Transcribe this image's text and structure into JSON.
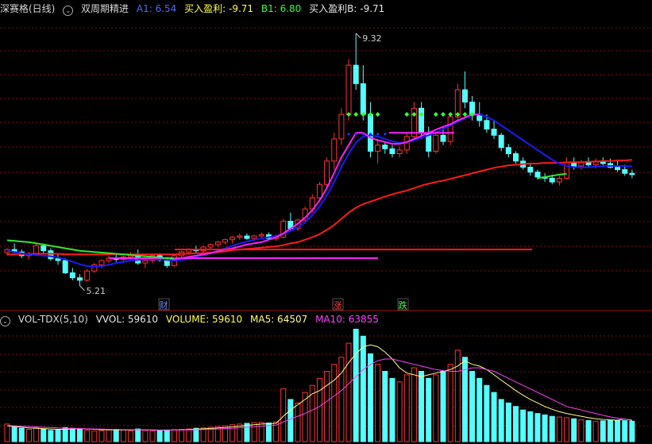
{
  "top_header": {
    "stock_name": "深赛格(日线)",
    "indicator_name": "双周期精进",
    "a1_label": "A1: 6.54",
    "buy_profit_label": "买入盈利: -9.71",
    "b1_label": "B1: 6.80",
    "buy_profit_b_label": "买入盈利B: -9.71"
  },
  "vol_header": {
    "indicator_name": "VOL-TDX(5,10)",
    "vvol_label": "VVOL: 59610",
    "volume_label": "VOLUME: 59610",
    "ma5_label": "MA5: 64507",
    "ma10_label": "MA10: 63855"
  },
  "annotations": {
    "high_price": "9.32",
    "low_price": "5.21",
    "marker_cai": "财",
    "marker_zhang": "涨",
    "marker_die": "跌"
  },
  "colors": {
    "up": "#ff3232",
    "down": "#54ffff",
    "ma_long_red": "#ff1a1a",
    "ma_magenta": "#ff20ff",
    "ma_blue": "#1a1aff",
    "ma_green": "#32e632",
    "grid": "#7a1010",
    "label_blue": "#4a6bff",
    "label_yellow": "#ffff44",
    "label_green": "#32ff32",
    "vol_ma5": "#ffff80",
    "vol_ma10": "#ff40ff"
  },
  "chart_data": [
    {
      "type": "candlestick",
      "title": "深赛格(日线)",
      "price_high": 9.32,
      "price_low": 5.21,
      "ylim": [
        5.0,
        9.5
      ],
      "candles": [
        [
          5.75,
          5.82,
          5.7,
          5.8
        ],
        [
          5.8,
          5.9,
          5.74,
          5.76
        ],
        [
          5.76,
          5.8,
          5.66,
          5.7
        ],
        [
          5.7,
          5.76,
          5.64,
          5.73
        ],
        [
          5.73,
          5.9,
          5.7,
          5.86
        ],
        [
          5.86,
          5.9,
          5.74,
          5.78
        ],
        [
          5.78,
          5.82,
          5.62,
          5.65
        ],
        [
          5.65,
          5.72,
          5.55,
          5.62
        ],
        [
          5.62,
          5.66,
          5.4,
          5.42
        ],
        [
          5.42,
          5.5,
          5.3,
          5.34
        ],
        [
          5.34,
          5.4,
          5.21,
          5.3
        ],
        [
          5.3,
          5.48,
          5.28,
          5.45
        ],
        [
          5.45,
          5.58,
          5.42,
          5.55
        ],
        [
          5.55,
          5.64,
          5.5,
          5.62
        ],
        [
          5.62,
          5.7,
          5.58,
          5.66
        ],
        [
          5.66,
          5.72,
          5.6,
          5.64
        ],
        [
          5.64,
          5.7,
          5.58,
          5.68
        ],
        [
          5.68,
          5.76,
          5.62,
          5.72
        ],
        [
          5.72,
          5.8,
          5.55,
          5.58
        ],
        [
          5.58,
          5.66,
          5.5,
          5.62
        ],
        [
          5.62,
          5.72,
          5.58,
          5.7
        ],
        [
          5.7,
          5.74,
          5.6,
          5.63
        ],
        [
          5.63,
          5.68,
          5.5,
          5.54
        ],
        [
          5.54,
          5.72,
          5.52,
          5.7
        ],
        [
          5.7,
          5.78,
          5.66,
          5.76
        ],
        [
          5.76,
          5.82,
          5.72,
          5.8
        ],
        [
          5.8,
          5.86,
          5.74,
          5.78
        ],
        [
          5.78,
          5.86,
          5.74,
          5.84
        ],
        [
          5.84,
          5.9,
          5.8,
          5.88
        ],
        [
          5.88,
          5.94,
          5.84,
          5.92
        ],
        [
          5.92,
          5.98,
          5.88,
          5.96
        ],
        [
          5.96,
          6.02,
          5.9,
          6.0
        ],
        [
          6.0,
          6.06,
          5.96,
          6.02
        ],
        [
          6.02,
          6.06,
          5.96,
          5.98
        ],
        [
          5.98,
          6.04,
          5.94,
          6.02
        ],
        [
          6.02,
          6.08,
          5.98,
          6.04
        ],
        [
          6.04,
          6.08,
          5.96,
          5.98
        ],
        [
          5.98,
          6.04,
          5.94,
          6.0
        ],
        [
          6.0,
          6.3,
          5.98,
          6.26
        ],
        [
          6.26,
          6.4,
          6.1,
          6.14
        ],
        [
          6.14,
          6.3,
          6.1,
          6.28
        ],
        [
          6.28,
          6.5,
          6.22,
          6.46
        ],
        [
          6.46,
          6.7,
          6.4,
          6.64
        ],
        [
          6.64,
          6.9,
          6.58,
          6.86
        ],
        [
          6.86,
          7.3,
          6.8,
          7.24
        ],
        [
          7.24,
          7.7,
          7.1,
          7.6
        ],
        [
          7.6,
          8.1,
          7.5,
          8.0
        ],
        [
          8.0,
          8.9,
          7.9,
          8.8
        ],
        [
          8.8,
          9.32,
          8.4,
          8.5
        ],
        [
          8.5,
          8.8,
          7.9,
          8.0
        ],
        [
          8.0,
          8.2,
          7.3,
          7.4
        ],
        [
          7.4,
          7.6,
          7.2,
          7.5
        ],
        [
          7.5,
          7.56,
          7.36,
          7.44
        ],
        [
          7.44,
          7.5,
          7.3,
          7.36
        ],
        [
          7.36,
          7.48,
          7.3,
          7.42
        ],
        [
          7.42,
          7.7,
          7.36,
          7.64
        ],
        [
          7.64,
          8.2,
          7.6,
          8.1
        ],
        [
          8.1,
          8.2,
          7.6,
          7.7
        ],
        [
          7.7,
          7.8,
          7.3,
          7.4
        ],
        [
          7.4,
          7.7,
          7.36,
          7.66
        ],
        [
          7.66,
          7.8,
          7.5,
          7.56
        ],
        [
          7.56,
          8.0,
          7.5,
          7.96
        ],
        [
          7.96,
          8.5,
          7.9,
          8.4
        ],
        [
          8.4,
          8.7,
          8.1,
          8.2
        ],
        [
          8.2,
          8.3,
          7.9,
          8.0
        ],
        [
          8.0,
          8.2,
          7.8,
          7.9
        ],
        [
          7.9,
          8.0,
          7.7,
          7.76
        ],
        [
          7.76,
          7.9,
          7.6,
          7.66
        ],
        [
          7.66,
          7.7,
          7.4,
          7.46
        ],
        [
          7.46,
          7.52,
          7.3,
          7.36
        ],
        [
          7.36,
          7.4,
          7.2,
          7.24
        ],
        [
          7.24,
          7.3,
          7.1,
          7.14
        ],
        [
          7.14,
          7.2,
          7.0,
          7.06
        ],
        [
          7.06,
          7.1,
          6.94,
          6.98
        ],
        [
          6.98,
          7.04,
          6.9,
          6.96
        ],
        [
          6.96,
          7.02,
          6.86,
          6.9
        ],
        [
          6.9,
          7.0,
          6.84,
          6.96
        ],
        [
          6.96,
          7.3,
          6.94,
          7.22
        ],
        [
          7.22,
          7.3,
          7.1,
          7.16
        ],
        [
          7.16,
          7.26,
          7.1,
          7.22
        ],
        [
          7.22,
          7.3,
          7.14,
          7.18
        ],
        [
          7.18,
          7.28,
          7.12,
          7.24
        ],
        [
          7.24,
          7.3,
          7.16,
          7.2
        ],
        [
          7.2,
          7.28,
          7.12,
          7.14
        ],
        [
          7.14,
          7.24,
          7.06,
          7.1
        ],
        [
          7.1,
          7.18,
          7.0,
          7.04
        ],
        [
          7.04,
          7.1,
          6.96,
          7.02
        ]
      ],
      "ma_long_red": [
        5.72,
        5.72,
        5.72,
        5.73,
        5.73,
        5.73,
        5.73,
        5.73,
        5.72,
        5.72,
        5.72,
        5.72,
        5.72,
        5.72,
        5.72,
        5.72,
        5.72,
        5.72,
        5.72,
        5.72,
        5.72,
        5.72,
        5.72,
        5.72,
        5.73,
        5.73,
        5.74,
        5.74,
        5.75,
        5.76,
        5.77,
        5.79,
        5.8,
        5.81,
        5.82,
        5.83,
        5.84,
        5.85,
        5.87,
        5.9,
        5.92,
        5.96,
        6.0,
        6.05,
        6.12,
        6.2,
        6.3,
        6.4,
        6.48,
        6.54,
        6.58,
        6.62,
        6.66,
        6.7,
        6.73,
        6.76,
        6.8,
        6.84,
        6.87,
        6.9,
        6.92,
        6.95,
        6.98,
        7.01,
        7.04,
        7.07,
        7.1,
        7.13,
        7.15,
        7.17,
        7.18,
        7.19,
        7.2,
        7.2,
        7.21,
        7.21,
        7.21,
        7.22,
        7.22,
        7.22,
        7.23,
        7.23,
        7.24,
        7.24,
        7.25,
        7.25,
        7.26
      ],
      "ma_magenta": [
        null,
        null,
        null,
        null,
        null,
        null,
        null,
        null,
        null,
        null,
        null,
        null,
        null,
        null,
        5.66,
        5.66,
        5.66,
        5.66,
        5.66,
        5.66,
        5.66,
        5.66,
        5.66,
        5.64,
        5.66,
        5.68,
        5.7,
        5.72,
        5.74,
        5.77,
        5.8,
        5.82,
        5.85,
        5.88,
        5.9,
        5.92,
        5.96,
        6.0,
        6.06,
        6.14,
        6.22,
        6.32,
        6.44,
        6.6,
        6.8,
        7.05,
        7.3,
        7.5,
        7.7,
        7.7,
        7.62,
        7.58,
        7.55,
        7.52,
        7.52,
        7.55,
        7.6,
        7.65,
        7.7,
        7.75,
        7.8,
        7.84,
        7.9,
        7.95,
        8.0,
        8.0,
        null,
        null,
        null,
        null,
        null,
        null,
        null,
        null,
        null,
        null,
        null,
        null,
        null,
        null,
        null,
        null,
        null,
        null,
        null,
        null,
        null
      ],
      "ma_blue": [
        5.78,
        5.76,
        5.74,
        5.72,
        5.71,
        5.7,
        5.69,
        5.67,
        5.64,
        5.6,
        5.56,
        5.53,
        5.52,
        5.53,
        5.55,
        5.58,
        5.6,
        5.62,
        5.63,
        5.64,
        5.64,
        5.64,
        5.63,
        5.62,
        5.63,
        5.65,
        5.68,
        5.71,
        5.74,
        5.78,
        5.82,
        5.86,
        5.9,
        5.93,
        5.96,
        5.98,
        6.0,
        6.02,
        6.06,
        6.1,
        6.16,
        6.24,
        6.36,
        6.5,
        6.68,
        6.9,
        7.14,
        7.36,
        7.54,
        7.64,
        7.66,
        7.64,
        7.6,
        7.56,
        7.54,
        7.55,
        7.58,
        7.62,
        7.66,
        7.7,
        7.76,
        7.82,
        7.88,
        7.94,
        7.98,
        8.0,
        7.96,
        7.9,
        7.82,
        7.74,
        7.66,
        7.58,
        7.5,
        7.42,
        7.34,
        7.26,
        7.2,
        7.16,
        7.14,
        7.14,
        7.14,
        7.15,
        7.16,
        7.16,
        7.16,
        7.16,
        7.15
      ],
      "ma_green": [
        5.95,
        5.94,
        5.93,
        5.92,
        5.9,
        5.88,
        5.86,
        5.84,
        5.82,
        5.8,
        5.78,
        5.77,
        5.76,
        5.75,
        5.74,
        5.73,
        5.72,
        5.71,
        5.7,
        5.69,
        5.68,
        5.67,
        5.66,
        5.66,
        null,
        null,
        null,
        null,
        null,
        null,
        null,
        null,
        null,
        null,
        null,
        null,
        null,
        null,
        null,
        null,
        null,
        null,
        null,
        null,
        null,
        null,
        null,
        null,
        null,
        null,
        null,
        null,
        null,
        null,
        null,
        null,
        null,
        null,
        null,
        null,
        null,
        null,
        null,
        null,
        null,
        null,
        null,
        null,
        null,
        null,
        null,
        null,
        null,
        6.96,
        6.98,
        7.0,
        7.02,
        7.03,
        null,
        null,
        null,
        null,
        null,
        null,
        null,
        null,
        null
      ]
    },
    {
      "type": "bar",
      "title": "VOL-TDX(5,10)",
      "series_name": "VOLUME",
      "values": [
        5000,
        4200,
        3800,
        3500,
        4000,
        3600,
        3200,
        3400,
        4000,
        3800,
        3600,
        3200,
        3000,
        3100,
        3300,
        3500,
        3400,
        3000,
        3600,
        3200,
        3000,
        3100,
        3300,
        3400,
        3500,
        3600,
        3800,
        3900,
        4100,
        4300,
        4500,
        4800,
        5000,
        5200,
        5400,
        5500,
        5300,
        5600,
        15000,
        12000,
        11000,
        14000,
        16000,
        18000,
        20000,
        22000,
        24000,
        28000,
        32000,
        30000,
        25000,
        22000,
        20000,
        18000,
        17000,
        19000,
        21000,
        20000,
        18000,
        19000,
        20000,
        22000,
        26000,
        24000,
        20000,
        18000,
        16000,
        14000,
        12000,
        11000,
        10000,
        9000,
        8500,
        8000,
        7600,
        7200,
        7000,
        6800,
        6500,
        6200,
        6000,
        5800,
        5900,
        6100,
        6000,
        5961,
        5800
      ],
      "ma5": [
        4500,
        4300,
        4100,
        3900,
        3800,
        3700,
        3600,
        3500,
        3500,
        3600,
        3700,
        3600,
        3500,
        3400,
        3400,
        3300,
        3300,
        3300,
        3350,
        3350,
        3300,
        3250,
        3250,
        3300,
        3350,
        3450,
        3550,
        3650,
        3750,
        3900,
        4050,
        4200,
        4400,
        4600,
        4800,
        5000,
        5100,
        5200,
        7200,
        9000,
        10500,
        12000,
        13600,
        14500,
        16000,
        17500,
        19500,
        22500,
        25000,
        27000,
        27500,
        27000,
        25500,
        23500,
        21000,
        19500,
        19000,
        18500,
        19000,
        19500,
        20000,
        20500,
        21500,
        23000,
        22000,
        21500,
        20500,
        19000,
        17500,
        16000,
        14500,
        13200,
        12000,
        11000,
        10000,
        9200,
        8500,
        8000,
        7600,
        7200,
        6800,
        6500,
        6300,
        6200,
        6100,
        6451,
        6000
      ],
      "ma10": [
        4600,
        4500,
        4400,
        4300,
        4200,
        4100,
        4000,
        3900,
        3800,
        3750,
        3700,
        3650,
        3600,
        3550,
        3500,
        3450,
        3400,
        3380,
        3360,
        3340,
        3320,
        3300,
        3300,
        3310,
        3320,
        3350,
        3400,
        3450,
        3500,
        3600,
        3700,
        3800,
        3950,
        4100,
        4250,
        4400,
        4550,
        4700,
        5600,
        6400,
        7200,
        8000,
        9000,
        10000,
        11500,
        13000,
        14500,
        16500,
        18500,
        20500,
        22000,
        23000,
        23500,
        23500,
        23000,
        22500,
        22000,
        21500,
        21000,
        20500,
        20200,
        20000,
        20000,
        20500,
        21000,
        21000,
        20500,
        20000,
        19000,
        18000,
        17000,
        16000,
        15000,
        14000,
        13000,
        12000,
        11000,
        10000,
        9500,
        9000,
        8500,
        8000,
        7500,
        7000,
        6700,
        6386,
        6200
      ]
    }
  ]
}
